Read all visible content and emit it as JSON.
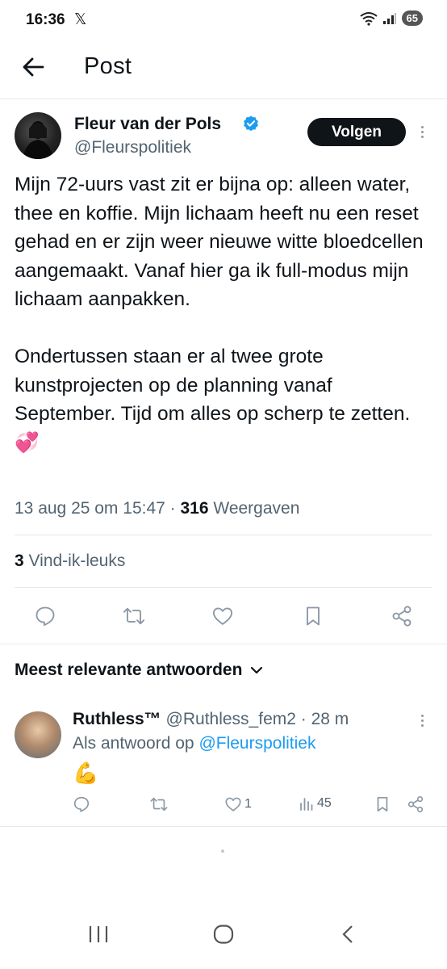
{
  "status_bar": {
    "time": "16:36",
    "x_glyph": "𝕏",
    "battery": "65"
  },
  "header": {
    "title": "Post"
  },
  "author": {
    "name": "Fleur van der Pols",
    "handle": "@Fleurspolitiek",
    "follow_label": "Volgen"
  },
  "post": {
    "text": "Mijn 72-uurs vast zit er bijna op: alleen water, thee en koffie. Mijn lichaam heeft nu een reset gehad en er zijn weer nieuwe witte bloedcellen aangemaakt. Vanaf hier ga ik full-modus mijn lichaam aanpakken.\n\nOndertussen staan er al twee grote kunstprojecten op de planning vanaf September. Tijd om alles op scherp te zetten. 💞",
    "timestamp": "13 aug 25 om 15:47",
    "separator": " · ",
    "views_count": "316",
    "views_label": " Weergaven",
    "likes_count": "3",
    "likes_label": " Vind-ik-leuks"
  },
  "replies_section": {
    "sort_label": "Meest relevante antwoorden"
  },
  "reply": {
    "name": "Ruthless™",
    "handle": "@Ruthless_fem2",
    "time": "· 28 m",
    "reply_prefix": "Als antwoord op ",
    "reply_to": "@Fleurspolitiek",
    "text": "💪",
    "like_count": "1",
    "views_count": "45"
  },
  "colors": {
    "accent": "#1d9bf0",
    "text": "#0f1419",
    "secondary": "#536471",
    "divider": "#e6e9ec"
  }
}
